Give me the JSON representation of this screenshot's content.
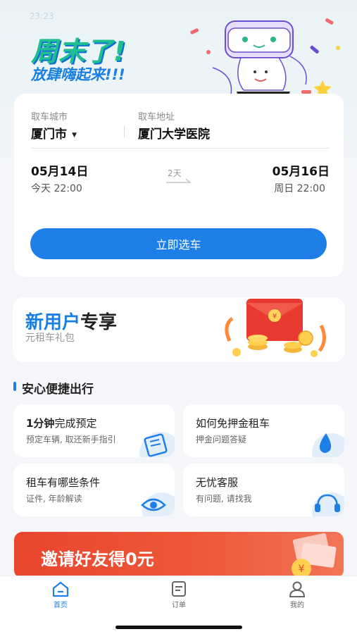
{
  "status_bar": {
    "time": "23:23"
  },
  "hero": {
    "title": "周末了!",
    "subtitle": "放肆嗨起来!!!"
  },
  "booking": {
    "pickup_city_label": "取车城市",
    "pickup_city_value": "厦门市",
    "pickup_address_label": "取车地址",
    "pickup_address_value": "厦门大学医院",
    "start_date": "05月14日",
    "start_time": "今天 22:00",
    "duration": "2天",
    "end_date": "05月16日",
    "end_time": "周日 22:00",
    "cta_label": "立即选车"
  },
  "promo": {
    "title_part1": "新用户",
    "title_part2": "专享",
    "subtitle": "元租车礼包"
  },
  "section": {
    "title": "安心便捷出行"
  },
  "tiles": [
    {
      "title_bold": "1分钟",
      "title_rest": "完成预定",
      "subtitle": "预定车辆, 取还新手指引",
      "icon": "document-icon"
    },
    {
      "title_bold": "",
      "title_rest": "如何免押金租车",
      "subtitle": "押金问题答疑",
      "icon": "droplet-icon"
    },
    {
      "title_bold": "",
      "title_rest": "租车有哪些条件",
      "subtitle": "证件, 年龄解读",
      "icon": "eye-icon"
    },
    {
      "title_bold": "",
      "title_rest": "无忧客服",
      "subtitle": "有问题, 请找我",
      "icon": "headset-icon"
    }
  ],
  "invite": {
    "title": "邀请好友得0元"
  },
  "tabbar": {
    "items": [
      {
        "label": "首页",
        "icon": "home-icon",
        "active": true
      },
      {
        "label": "订单",
        "icon": "order-icon",
        "active": false
      },
      {
        "label": "我的",
        "icon": "profile-icon",
        "active": false
      }
    ]
  },
  "colors": {
    "accent": "#1f7fe8",
    "hero_green": "#1fbf8f",
    "invite_red": "#e8452d"
  }
}
